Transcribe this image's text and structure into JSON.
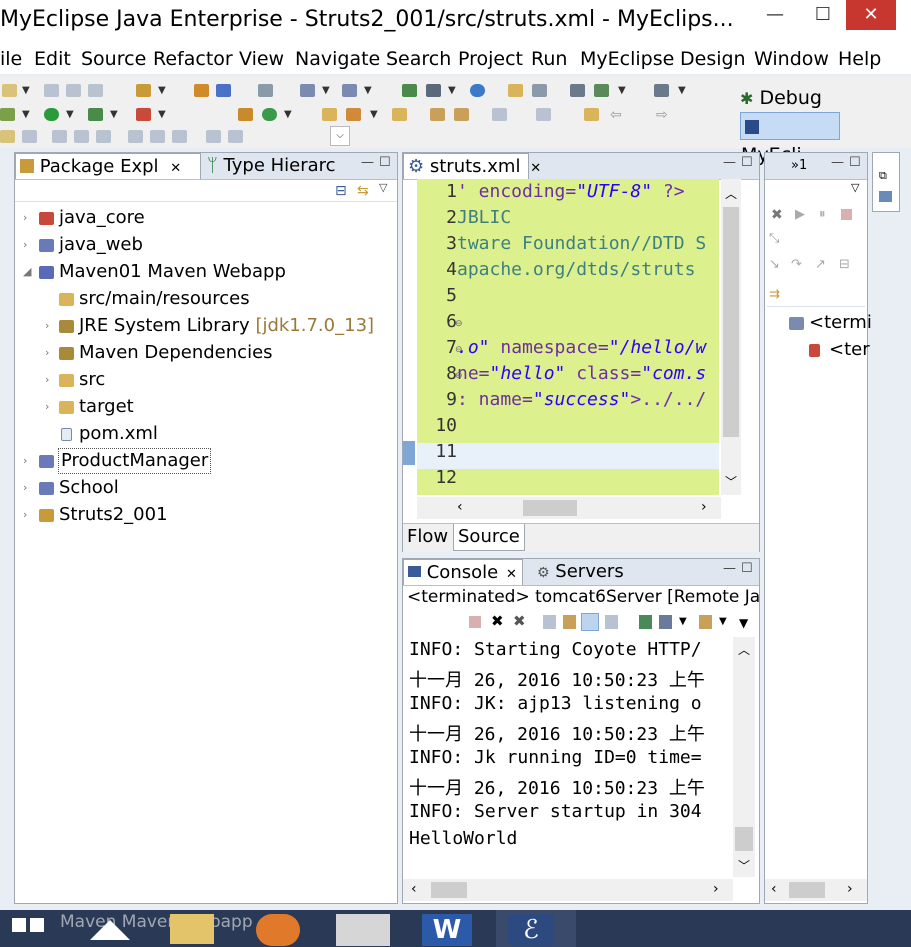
{
  "window": {
    "title": "MyEclipse Java Enterprise - Struts2_001/src/struts.xml - MyEclips...",
    "minimize": "—",
    "maximize": "☐",
    "close": "✕"
  },
  "menu": [
    "ile",
    "Edit",
    "Source",
    "Refactor",
    "View",
    "Navigate",
    "Search",
    "Project",
    "Run",
    "MyEclipse",
    "Design",
    "Window",
    "Help"
  ],
  "perspectives": {
    "debug": "Debug",
    "myeclipse": "MyEcli..."
  },
  "package_explorer": {
    "tab_label": "Package Expl",
    "tab2_label": "Type Hierarc",
    "items": [
      {
        "label": "java_core"
      },
      {
        "label": "java_web"
      },
      {
        "label": "Maven01 Maven Webapp"
      },
      {
        "label": "src/main/resources"
      },
      {
        "label": "JRE System Library",
        "suffix": "[jdk1.7.0_13]"
      },
      {
        "label": "Maven Dependencies"
      },
      {
        "label": "src"
      },
      {
        "label": "target"
      },
      {
        "label": "pom.xml"
      },
      {
        "label": "ProductManager"
      },
      {
        "label": "School"
      },
      {
        "label": "Struts2_001"
      }
    ]
  },
  "editor": {
    "tab_label": "struts.xml",
    "line_numbers": [
      "1",
      "2",
      "3",
      "4",
      "5",
      "6",
      "7",
      "8",
      "9",
      "10",
      "11",
      "12"
    ],
    "lines": {
      "l1_a": "' encoding=",
      "l1_b": "\"UTF-8\"",
      "l1_c": " ?>",
      "l2": "JBLIC",
      "l3": "tware Foundation//DTD S",
      "l4": "apache.org/dtds/struts",
      "l7_a": ".o\"",
      "l7_b": " namespace=",
      "l7_c": "\"/hello/w",
      "l8_a": "ne=",
      "l8_b": "\"hello\"",
      "l8_c": " class=",
      "l8_d": "\"com.s",
      "l9_a": ": name=",
      "l9_b": "\"success\"",
      "l9_c": ">../../"
    },
    "bottom_tabs": {
      "flow": "Flow",
      "source": "Source"
    }
  },
  "console": {
    "tab_label": "Console",
    "tab2_label": "Servers",
    "status": "<terminated> tomcat6Server [Remote Ja",
    "lines": [
      "INFO: Starting Coyote HTTP/",
      "十一月 26, 2016 10:50:23 上午",
      "INFO: JK: ajp13 listening o",
      "十一月 26, 2016 10:50:23 上午",
      "INFO: Jk running ID=0 time=",
      "十一月 26, 2016 10:50:23 上午",
      "INFO: Server startup in 304",
      "HelloWorld"
    ]
  },
  "right_panel": {
    "tab_label": "»1",
    "items": [
      "<termi",
      "<ter"
    ]
  },
  "taskbar": {
    "ghost_label": "Maven Maven Webapp"
  },
  "colors": {
    "editor_bg": "#dcf08e",
    "keyword": "#6e2ea0",
    "string": "#2a00ff",
    "close_button": "#c7372f"
  }
}
